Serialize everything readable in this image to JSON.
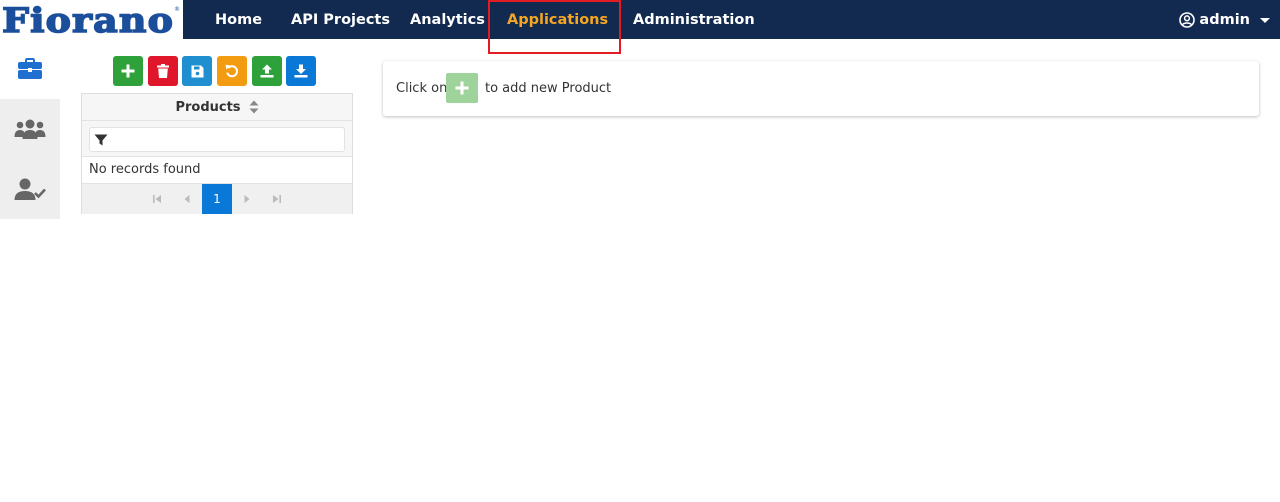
{
  "brand": {
    "name": "Fiorano",
    "color": "#1b4f9c"
  },
  "nav": {
    "items": [
      {
        "label": "Home"
      },
      {
        "label": "API Projects"
      },
      {
        "label": "Analytics"
      },
      {
        "label": "Applications",
        "active": true
      },
      {
        "label": "Administration"
      }
    ],
    "user": "admin"
  },
  "colors": {
    "topbar": "#122a4f",
    "active_nav": "#f5a623",
    "add": "#2ea13a",
    "delete": "#e0162b",
    "save": "#1f8fcf",
    "reset": "#f39c12",
    "upload": "#2ea13a",
    "download": "#0a78d6",
    "highlight": "#e31b23"
  },
  "sidebar": {
    "items": [
      {
        "icon": "briefcase-icon",
        "active": true
      },
      {
        "icon": "users-icon",
        "active": false
      },
      {
        "icon": "user-check-icon",
        "active": false
      }
    ]
  },
  "toolbar": {
    "buttons": [
      {
        "icon": "plus-icon",
        "action": "add"
      },
      {
        "icon": "trash-icon",
        "action": "delete"
      },
      {
        "icon": "floppy-disk-icon",
        "action": "save"
      },
      {
        "icon": "undo-icon",
        "action": "reset"
      },
      {
        "icon": "upload-icon",
        "action": "import"
      },
      {
        "icon": "download-icon",
        "action": "export"
      }
    ]
  },
  "products_grid": {
    "column_header": "Products",
    "filter_value": "",
    "empty_message": "No records found",
    "current_page": "1"
  },
  "info_panel": {
    "prefix": "Click on",
    "suffix": "to add new Product"
  }
}
